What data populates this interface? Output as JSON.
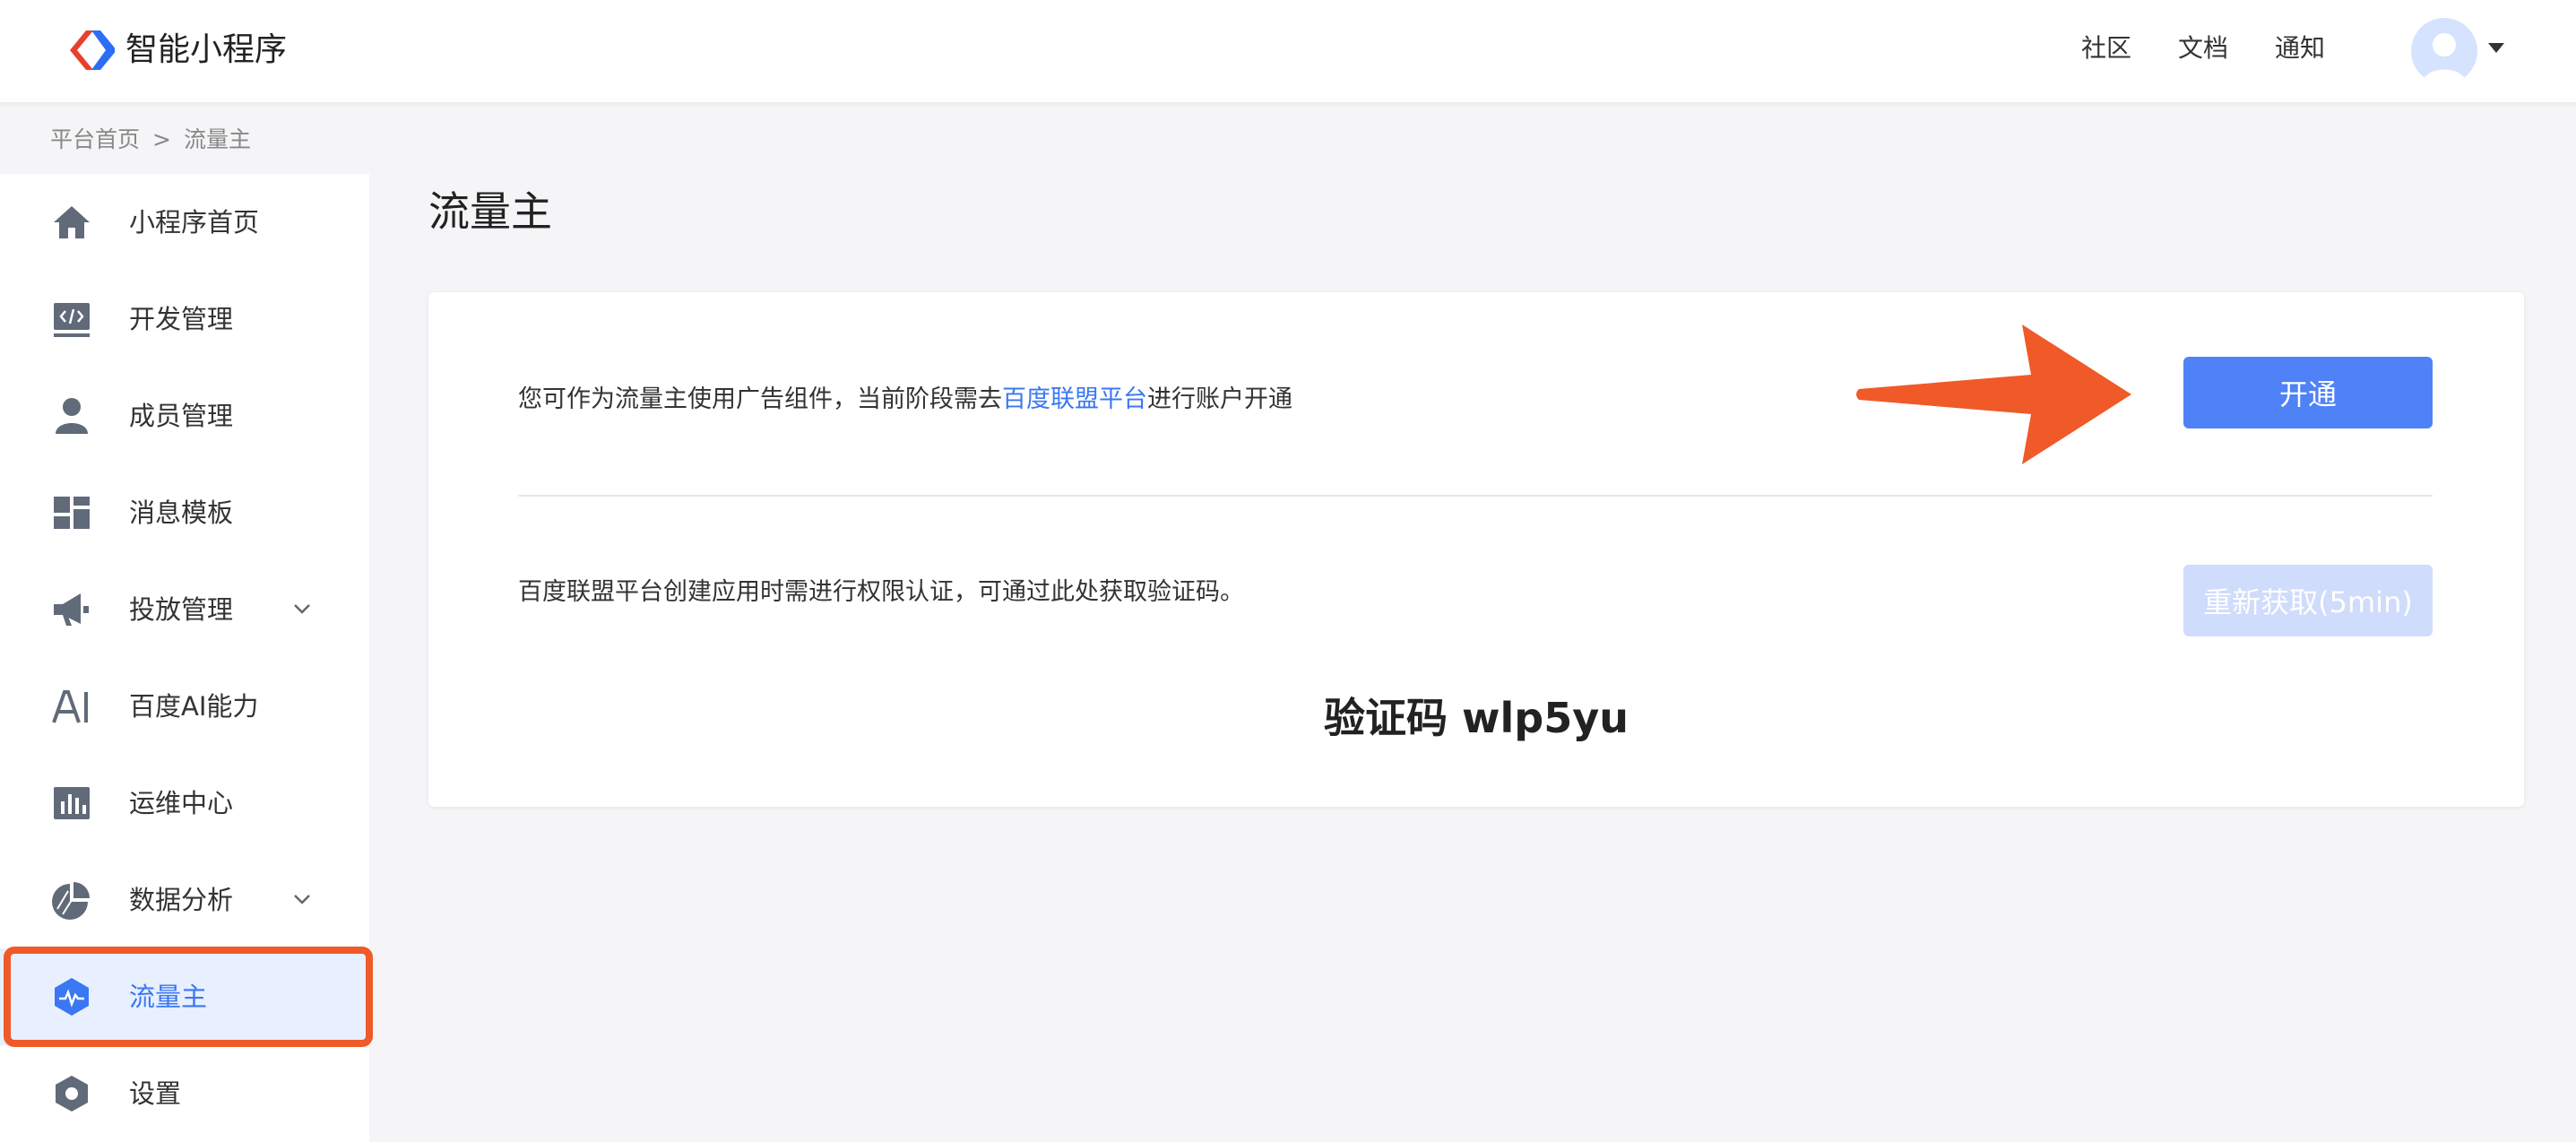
{
  "header": {
    "app_name": "智能小程序",
    "nav": [
      "社区",
      "文档",
      "通知"
    ]
  },
  "breadcrumb": {
    "items": [
      "平台首页",
      ">",
      "流量主"
    ]
  },
  "sidebar": {
    "items": [
      {
        "label": "小程序首页",
        "icon": "home-icon"
      },
      {
        "label": "开发管理",
        "icon": "code-icon"
      },
      {
        "label": "成员管理",
        "icon": "user-icon"
      },
      {
        "label": "消息模板",
        "icon": "template-icon"
      },
      {
        "label": "投放管理",
        "icon": "megaphone-icon",
        "expandable": true
      },
      {
        "label": "百度AI能力",
        "icon": "ai-icon"
      },
      {
        "label": "运维中心",
        "icon": "bar-chart-icon"
      },
      {
        "label": "数据分析",
        "icon": "pie-chart-icon",
        "expandable": true
      },
      {
        "label": "流量主",
        "icon": "pulse-icon",
        "active": true
      },
      {
        "label": "设置",
        "icon": "settings-icon"
      }
    ]
  },
  "main": {
    "title": "流量主",
    "desc1_prefix": "您可作为流量主使用广告组件，当前阶段需去",
    "desc1_link": "百度联盟平台",
    "desc1_suffix": "进行账户开通",
    "open_button": "开通",
    "desc2": "百度联盟平台创建应用时需进行权限认证，可通过此处获取验证码。",
    "refresh_button": "重新获取(5min)",
    "code_label": "验证码",
    "code_value": "wlp5yu"
  },
  "colors": {
    "accent": "#4f82f6",
    "link": "#3a77f3",
    "highlight": "#ef5a28",
    "active_bg": "#e8efff",
    "disabled_btn": "#cfdcfb"
  }
}
